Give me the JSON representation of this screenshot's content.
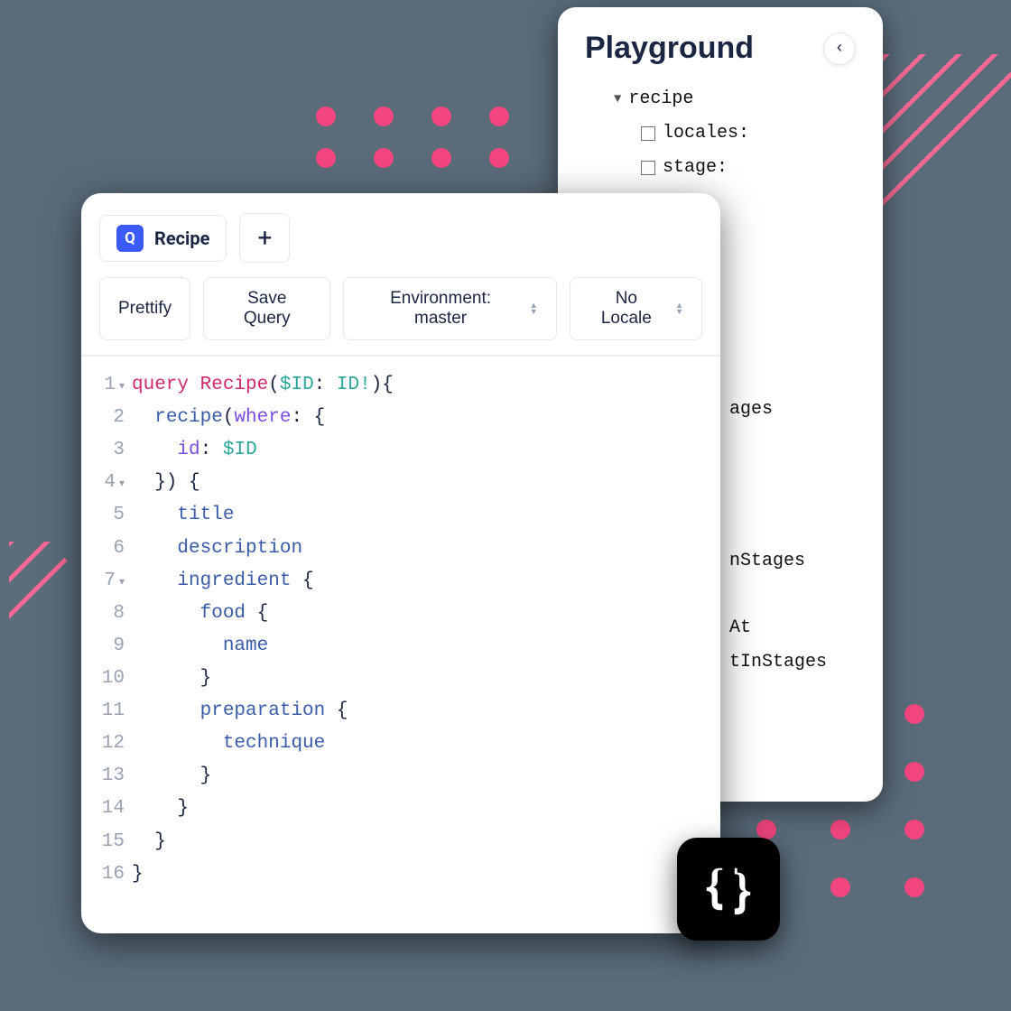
{
  "playground": {
    "title": "Playground",
    "tree": {
      "root": "recipe",
      "children": [
        {
          "label": "locales:"
        },
        {
          "label": "stage:"
        }
      ],
      "extra": [
        "ages",
        "nStages",
        "At",
        "tInStages"
      ]
    }
  },
  "editor": {
    "tab": {
      "badge": "Q",
      "label": "Recipe"
    },
    "toolbar": {
      "prettify": "Prettify",
      "save": "Save Query",
      "env_prefix": "Environment: ",
      "env_value": "master",
      "locale": "No Locale"
    },
    "code": {
      "lines": [
        {
          "n": 1,
          "fold": true,
          "seg": [
            [
              "t-key",
              "query "
            ],
            [
              "t-key",
              "Recipe"
            ],
            [
              "t-punc",
              "("
            ],
            [
              "t-var",
              "$ID"
            ],
            [
              "t-punc",
              ": "
            ],
            [
              "t-type",
              "ID!"
            ],
            [
              "t-punc",
              "){"
            ]
          ]
        },
        {
          "n": 2,
          "fold": false,
          "seg": [
            [
              "t-punc",
              "  "
            ],
            [
              "t-field",
              "recipe"
            ],
            [
              "t-punc",
              "("
            ],
            [
              "t-arg",
              "where"
            ],
            [
              "t-punc",
              ": {"
            ]
          ]
        },
        {
          "n": 3,
          "fold": false,
          "seg": [
            [
              "t-punc",
              "    "
            ],
            [
              "t-arg",
              "id"
            ],
            [
              "t-punc",
              ": "
            ],
            [
              "t-var",
              "$ID"
            ]
          ]
        },
        {
          "n": 4,
          "fold": true,
          "seg": [
            [
              "t-punc",
              "  }) {"
            ]
          ]
        },
        {
          "n": 5,
          "fold": false,
          "seg": [
            [
              "t-punc",
              "    "
            ],
            [
              "t-field",
              "title"
            ]
          ]
        },
        {
          "n": 6,
          "fold": false,
          "seg": [
            [
              "t-punc",
              "    "
            ],
            [
              "t-field",
              "description"
            ]
          ]
        },
        {
          "n": 7,
          "fold": true,
          "seg": [
            [
              "t-punc",
              "    "
            ],
            [
              "t-field",
              "ingredient"
            ],
            [
              "t-punc",
              " {"
            ]
          ]
        },
        {
          "n": 8,
          "fold": false,
          "seg": [
            [
              "t-punc",
              "      "
            ],
            [
              "t-field",
              "food"
            ],
            [
              "t-punc",
              " {"
            ]
          ]
        },
        {
          "n": 9,
          "fold": false,
          "seg": [
            [
              "t-punc",
              "        "
            ],
            [
              "t-field",
              "name"
            ]
          ]
        },
        {
          "n": 10,
          "fold": false,
          "seg": [
            [
              "t-punc",
              "      }"
            ]
          ]
        },
        {
          "n": 11,
          "fold": false,
          "seg": [
            [
              "t-punc",
              "      "
            ],
            [
              "t-field",
              "preparation"
            ],
            [
              "t-punc",
              " {"
            ]
          ]
        },
        {
          "n": 12,
          "fold": false,
          "seg": [
            [
              "t-punc",
              "        "
            ],
            [
              "t-field",
              "technique"
            ]
          ]
        },
        {
          "n": 13,
          "fold": false,
          "seg": [
            [
              "t-punc",
              "      }"
            ]
          ]
        },
        {
          "n": 14,
          "fold": false,
          "seg": [
            [
              "t-punc",
              "    }"
            ]
          ]
        },
        {
          "n": 15,
          "fold": false,
          "seg": [
            [
              "t-punc",
              "  }"
            ]
          ]
        },
        {
          "n": 16,
          "fold": false,
          "seg": [
            [
              "t-punc",
              "}"
            ]
          ]
        }
      ]
    }
  },
  "colors": {
    "accent": "#f3467e",
    "primary": "#3b5bff"
  }
}
